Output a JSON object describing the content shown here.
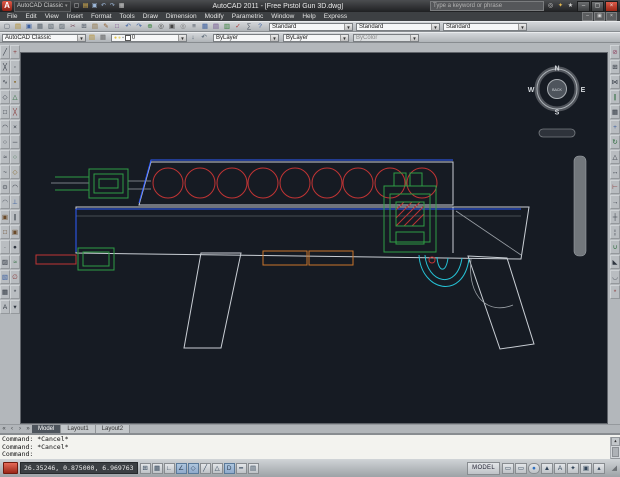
{
  "titlebar": {
    "app_button": "A",
    "workspace": "AutoCAD Classic",
    "title": "AutoCAD 2011 - [Free Pistol Gun 3D.dwg]",
    "search_placeholder": "Type a keyword or phrase",
    "quick_access_icons": [
      {
        "name": "qnew-icon",
        "glyph": "▢",
        "color": "#d8d8d8"
      },
      {
        "name": "open-icon",
        "glyph": "▤",
        "color": "#e0b64f"
      },
      {
        "name": "save-icon",
        "glyph": "▣",
        "color": "#9db7d8"
      },
      {
        "name": "undo-icon",
        "glyph": "↶",
        "color": "#9db7d8"
      },
      {
        "name": "redo-icon",
        "glyph": "↷",
        "color": "#9db7d8"
      },
      {
        "name": "plot-icon",
        "glyph": "▦",
        "color": "#c8c8c8"
      }
    ],
    "infocenter_icons": [
      {
        "name": "search-icon",
        "glyph": "◎",
        "color": "#d2d2d2"
      },
      {
        "name": "communication-center-icon",
        "glyph": "✦",
        "color": "#e0b64f"
      },
      {
        "name": "favorites-icon",
        "glyph": "★",
        "color": "#d2d2d2"
      }
    ],
    "window_buttons": [
      {
        "name": "minimize-button",
        "glyph": "–"
      },
      {
        "name": "maximize-button",
        "glyph": "▢"
      },
      {
        "name": "close-button",
        "glyph": "×",
        "close": true
      }
    ]
  },
  "menubar": {
    "items": [
      "File",
      "Edit",
      "View",
      "Insert",
      "Format",
      "Tools",
      "Draw",
      "Dimension",
      "Modify",
      "Parametric",
      "Window",
      "Help",
      "Express"
    ],
    "doc_buttons": [
      {
        "name": "doc-minimize-button",
        "glyph": "–"
      },
      {
        "name": "doc-restore-button",
        "glyph": "▣"
      },
      {
        "name": "doc-close-button",
        "glyph": "×"
      }
    ]
  },
  "toolbar_standard": {
    "icons": [
      {
        "name": "qnew-icon",
        "glyph": "▢",
        "color": "#4a5360"
      },
      {
        "name": "open-icon",
        "glyph": "▤",
        "color": "#b08a28"
      },
      {
        "name": "save-icon",
        "glyph": "▣",
        "color": "#3b5fa0"
      },
      {
        "name": "plot-icon",
        "glyph": "▦",
        "color": "#55606a"
      },
      {
        "name": "plot-preview-icon",
        "glyph": "▧",
        "color": "#55606a"
      },
      {
        "name": "publish-icon",
        "glyph": "▨",
        "color": "#55606a"
      },
      {
        "name": "cut-icon",
        "glyph": "✂",
        "color": "#7a5060"
      },
      {
        "name": "copy-clip-icon",
        "glyph": "⊞",
        "color": "#4a5360"
      },
      {
        "name": "paste-icon",
        "glyph": "▤",
        "color": "#8a6d3b"
      },
      {
        "name": "match-properties-icon",
        "glyph": "✎",
        "color": "#8a5a2b"
      },
      {
        "name": "block-editor-icon",
        "glyph": "□",
        "color": "#7a4a8a"
      },
      {
        "name": "undo-icon",
        "glyph": "↶",
        "color": "#3b5fa0"
      },
      {
        "name": "redo-icon",
        "glyph": "↷",
        "color": "#3b5fa0"
      },
      {
        "name": "pan-realtime-icon",
        "glyph": "⊕",
        "color": "#2e7d32"
      },
      {
        "name": "zoom-realtime-icon",
        "glyph": "◎",
        "color": "#444"
      },
      {
        "name": "zoom-window-icon",
        "glyph": "▣",
        "color": "#444"
      },
      {
        "name": "zoom-previous-icon",
        "glyph": "◎",
        "color": "#777"
      },
      {
        "name": "properties-icon",
        "glyph": "≡",
        "color": "#4a5360"
      },
      {
        "name": "designcenter-icon",
        "glyph": "▦",
        "color": "#3b5fa0"
      },
      {
        "name": "tool-palettes-icon",
        "glyph": "▤",
        "color": "#6a4a8a"
      },
      {
        "name": "sheet-set-manager-icon",
        "glyph": "▥",
        "color": "#2e7d32"
      },
      {
        "name": "markup-set-manager-icon",
        "glyph": "✓",
        "color": "#a33"
      },
      {
        "name": "quickcalc-icon",
        "glyph": "∑",
        "color": "#4a5360"
      },
      {
        "name": "help-icon",
        "glyph": "?",
        "color": "#3b5fa0"
      }
    ],
    "style_combos": [
      {
        "name": "text-style-combo",
        "label": "Standard"
      },
      {
        "name": "dim-style-combo",
        "label": "Standard"
      },
      {
        "name": "table-style-combo",
        "label": "Standard"
      }
    ]
  },
  "toolbar_layers": {
    "workspace_combo": "AutoCAD Classic",
    "icons_before": [
      {
        "name": "layer-properties-manager-icon",
        "glyph": "▤",
        "color": "#b08a28"
      },
      {
        "name": "layer-states-manager-icon",
        "glyph": "▦",
        "color": "#666"
      }
    ],
    "layer_combo": {
      "status_glyphs": [
        {
          "name": "layer-on-bulb-icon",
          "glyph": "●",
          "color": "#e2c34a"
        },
        {
          "name": "layer-freeze-sun-icon",
          "glyph": "●",
          "color": "#e8d879"
        },
        {
          "name": "layer-lock-icon",
          "glyph": "▪",
          "color": "#8a8e92"
        }
      ],
      "layer_name": "0"
    },
    "icons_after": [
      {
        "name": "make-object-layer-current-icon",
        "glyph": "↓",
        "color": "#4a5a6a"
      },
      {
        "name": "layer-previous-icon",
        "glyph": "↶",
        "color": "#4a5a6a"
      }
    ],
    "color_combo": "ByLayer",
    "linetype_combo": "ByLayer",
    "plotstyle_combo": "ByColor"
  },
  "dock_left_draw": {
    "items": [
      {
        "name": "line-tool",
        "glyph": "╱",
        "color": "#2f3640"
      },
      {
        "name": "construction-line-tool",
        "glyph": "╳",
        "color": "#2f3640"
      },
      {
        "name": "polyline-tool",
        "glyph": "∿",
        "color": "#2f3640"
      },
      {
        "name": "polygon-tool",
        "glyph": "◇",
        "color": "#2f3640"
      },
      {
        "name": "rectangle-tool",
        "glyph": "□",
        "color": "#2f3640"
      },
      {
        "name": "arc-tool",
        "glyph": "◠",
        "color": "#2f3640"
      },
      {
        "name": "circle-tool",
        "glyph": "○",
        "color": "#2f3640"
      },
      {
        "name": "revcloud-tool",
        "glyph": "≈",
        "color": "#2f3640"
      },
      {
        "name": "spline-tool",
        "glyph": "~",
        "color": "#2f3640"
      },
      {
        "name": "ellipse-tool",
        "glyph": "⊙",
        "color": "#2f3640"
      },
      {
        "name": "ellipse-arc-tool",
        "glyph": "◠",
        "color": "#555c66"
      },
      {
        "name": "insert-block-tool",
        "glyph": "▣",
        "color": "#6a4a2a"
      },
      {
        "name": "make-block-tool",
        "glyph": "□",
        "color": "#6a4a2a"
      },
      {
        "name": "point-tool",
        "glyph": "·",
        "color": "#2f3640"
      },
      {
        "name": "hatch-tool",
        "glyph": "▨",
        "color": "#2f3640"
      },
      {
        "name": "gradient-tool",
        "glyph": "▧",
        "color": "#3b5fa0"
      },
      {
        "name": "region-tool",
        "glyph": "▦",
        "color": "#2f3640"
      },
      {
        "name": "mtext-tool",
        "glyph": "A",
        "color": "#2f3640"
      }
    ]
  },
  "dock_left_osnap": {
    "items": [
      {
        "name": "temporary-track-point",
        "glyph": "+",
        "color": "#8a3a3a"
      },
      {
        "name": "snap-from",
        "glyph": "◦",
        "color": "#2f3640"
      },
      {
        "name": "snap-endpoint",
        "glyph": "▪",
        "color": "#8a6a2a"
      },
      {
        "name": "snap-midpoint",
        "glyph": "△",
        "color": "#2a6a3a"
      },
      {
        "name": "snap-intersection",
        "glyph": "╳",
        "color": "#8a3a3a"
      },
      {
        "name": "snap-apparent-intersection",
        "glyph": "×",
        "color": "#2f3640"
      },
      {
        "name": "snap-extension",
        "glyph": "─",
        "color": "#2f3640"
      },
      {
        "name": "snap-center",
        "glyph": "○",
        "color": "#2a6a3a"
      },
      {
        "name": "snap-quadrant",
        "glyph": "◇",
        "color": "#8a6a2a"
      },
      {
        "name": "snap-tangent",
        "glyph": "◠",
        "color": "#2f3640"
      },
      {
        "name": "snap-perpendicular",
        "glyph": "⊥",
        "color": "#3b5fa0"
      },
      {
        "name": "snap-parallel",
        "glyph": "∥",
        "color": "#2f3640"
      },
      {
        "name": "snap-insert",
        "glyph": "▣",
        "color": "#6a4a2a"
      },
      {
        "name": "snap-node",
        "glyph": "●",
        "color": "#2f3640"
      },
      {
        "name": "snap-nearest",
        "glyph": "≈",
        "color": "#2a6a3a"
      },
      {
        "name": "snap-none",
        "glyph": "∅",
        "color": "#8a3a3a"
      },
      {
        "name": "osnap-settings",
        "glyph": "*",
        "color": "#2f3640"
      },
      {
        "name": "point-filters",
        "glyph": "▾",
        "color": "#2f3640"
      }
    ]
  },
  "dock_right_modify": {
    "items": [
      {
        "name": "erase-tool",
        "glyph": "⊘",
        "color": "#8a3a5a"
      },
      {
        "name": "copy-tool",
        "glyph": "⊞",
        "color": "#2f3640"
      },
      {
        "name": "mirror-tool",
        "glyph": "⋈",
        "color": "#2f3640"
      },
      {
        "name": "offset-tool",
        "glyph": "∥",
        "color": "#2a6a3a"
      },
      {
        "name": "array-tool",
        "glyph": "▦",
        "color": "#2f3640"
      },
      {
        "name": "move-tool",
        "glyph": "+",
        "color": "#3b5fa0"
      },
      {
        "name": "rotate-tool",
        "glyph": "↻",
        "color": "#2a6a3a"
      },
      {
        "name": "scale-tool",
        "glyph": "△",
        "color": "#2f3640"
      },
      {
        "name": "stretch-tool",
        "glyph": "↔",
        "color": "#2f3640"
      },
      {
        "name": "trim-tool",
        "glyph": "⊢",
        "color": "#8a3a3a"
      },
      {
        "name": "extend-tool",
        "glyph": "→",
        "color": "#2f3640"
      },
      {
        "name": "break-at-point-tool",
        "glyph": "┼",
        "color": "#2f3640"
      },
      {
        "name": "break-tool",
        "glyph": "¦",
        "color": "#2f3640"
      },
      {
        "name": "join-tool",
        "glyph": "∪",
        "color": "#2a6a3a"
      },
      {
        "name": "chamfer-tool",
        "glyph": "◣",
        "color": "#2f3640"
      },
      {
        "name": "fillet-tool",
        "glyph": "◡",
        "color": "#2f3640"
      },
      {
        "name": "explode-tool",
        "glyph": "*",
        "color": "#8a3a3a"
      }
    ]
  },
  "canvas": {
    "compass": {
      "north": "N",
      "south": "S",
      "east": "E",
      "west": "W",
      "face": "BACK"
    }
  },
  "layout_bar": {
    "nav": [
      {
        "name": "first-tab-button",
        "glyph": "«"
      },
      {
        "name": "prev-tab-button",
        "glyph": "‹"
      },
      {
        "name": "next-tab-button",
        "glyph": "›"
      },
      {
        "name": "last-tab-button",
        "glyph": "»"
      }
    ],
    "tabs": [
      {
        "label": "Model",
        "active": true
      },
      {
        "label": "Layout1"
      },
      {
        "label": "Layout2"
      }
    ]
  },
  "command": {
    "lines": [
      "Command: *Cancel*",
      "Command: *Cancel*",
      "Command:"
    ]
  },
  "statusbar": {
    "coordinates": "26.35246, 0.875000, 6.969763",
    "toggles": [
      {
        "name": "snap-toggle",
        "glyph": "⊞"
      },
      {
        "name": "grid-toggle",
        "glyph": "▦"
      },
      {
        "name": "ortho-toggle",
        "glyph": "∟"
      },
      {
        "name": "polar-toggle",
        "glyph": "∠",
        "pressed": true
      },
      {
        "name": "osnap-toggle",
        "glyph": "◇",
        "pressed": true
      },
      {
        "name": "otrack-toggle",
        "glyph": "╱"
      },
      {
        "name": "ducs-toggle",
        "glyph": "△"
      },
      {
        "name": "dyn-toggle",
        "glyph": "D",
        "pressed": true
      },
      {
        "name": "lwt-toggle",
        "glyph": "━"
      },
      {
        "name": "qp-toggle",
        "glyph": "▤"
      }
    ],
    "model_label": "MODEL",
    "right_icons": [
      {
        "name": "quick-view-layouts-icon",
        "glyph": "▭"
      },
      {
        "name": "quick-view-drawings-icon",
        "glyph": "▭"
      },
      {
        "name": "status-notify-icon",
        "glyph": "●",
        "blue": true
      },
      {
        "name": "annotation-scale-icon",
        "glyph": "▲"
      },
      {
        "name": "annotation-visibility-icon",
        "glyph": "A"
      },
      {
        "name": "workspace-switch-icon",
        "glyph": "✦"
      },
      {
        "name": "toolbar-lock-icon",
        "glyph": "▣"
      },
      {
        "name": "tray-arrow-icon",
        "glyph": "▴"
      }
    ],
    "corner_glyph": "◢"
  }
}
